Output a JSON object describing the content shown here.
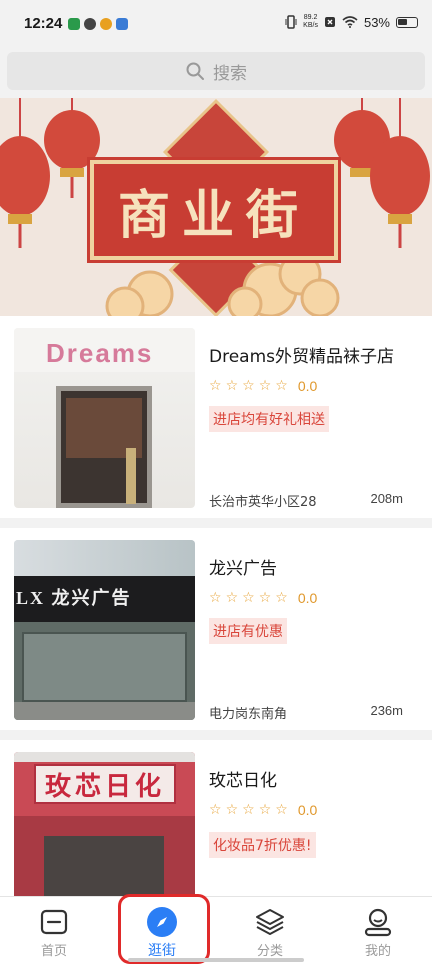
{
  "status": {
    "time": "12:24",
    "net_speed": "89.2\nKB/s",
    "battery": "53%"
  },
  "search": {
    "placeholder": "搜索",
    "icon": "search-icon"
  },
  "banner": {
    "title": "商业街"
  },
  "shops": [
    {
      "name": "Dreams外贸精品袜子店",
      "rating": "0.0",
      "promo": "进店均有好礼相送",
      "address": "长治市英华小区28",
      "distance": "208m",
      "sign": "Dreams"
    },
    {
      "name": "龙兴广告",
      "rating": "0.0",
      "promo": "进店有优惠",
      "address": "电力岗东南角",
      "distance": "236m",
      "sign": "LX 龙兴广告"
    },
    {
      "name": "玫芯日化",
      "rating": "0.0",
      "promo": "化妆品7折优惠!",
      "address": "",
      "distance": "",
      "sign": "玫芯日化"
    }
  ],
  "tabs": [
    {
      "label": "首页",
      "icon": "home-icon"
    },
    {
      "label": "逛街",
      "icon": "compass-icon",
      "active": true
    },
    {
      "label": "分类",
      "icon": "layers-icon"
    },
    {
      "label": "我的",
      "icon": "user-icon"
    }
  ],
  "colors": {
    "accent": "#2b7ef5",
    "promo_text": "#d9463b",
    "star": "#e8a53a",
    "highlight": "#e02a2a"
  }
}
